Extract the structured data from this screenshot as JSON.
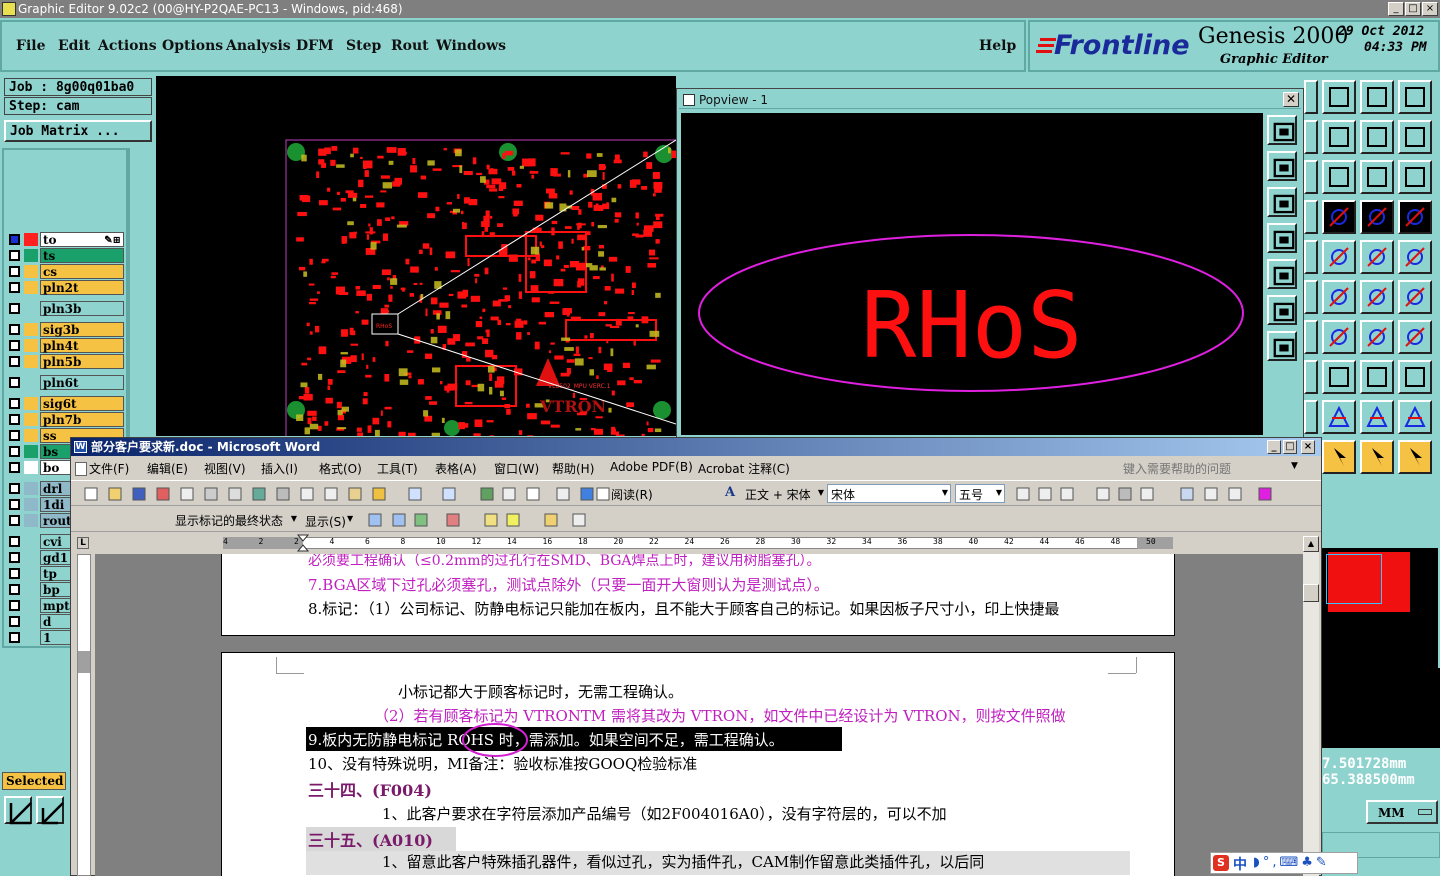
{
  "app": {
    "title": "Graphic Editor 9.02c2 (00@HY-P2QAE-PC13 - Windows, pid:468)",
    "menu": [
      "File",
      "Edit",
      "Actions",
      "Options",
      "Analysis",
      "DFM",
      "Step",
      "Rout",
      "Windows"
    ],
    "help": "Help",
    "brand": "Frontline",
    "product": "Genesis 2000",
    "subtitle": "Graphic Editor",
    "date": "29 Oct 2012",
    "time": "04:33 PM",
    "colors": {
      "panel": "#8fd3cf",
      "canvas": "#000000",
      "copper": "#ff1010",
      "outline": "#e020e0"
    }
  },
  "left_panel": {
    "job": "Job : 8g00q01ba0",
    "step": "Step: cam",
    "job_matrix": "Job Matrix ...",
    "layers": [
      {
        "name": "to",
        "color": "#ffffff",
        "swatch": "#ff2020",
        "flag": "✎⊞"
      },
      {
        "name": "ts",
        "color": "#1aa06a",
        "swatch": "#1aa06a",
        "flag": ""
      },
      {
        "name": "cs",
        "color": "#f5c244",
        "swatch": "#f5c244",
        "flag": ""
      },
      {
        "name": "pln2t",
        "color": "#f5c244",
        "swatch": "#f5c244",
        "flag": ""
      },
      {
        "name": "pln3b",
        "color": "#8fd3cf",
        "swatch": "#8fd3cf",
        "flag": ""
      },
      {
        "name": "sig3b",
        "color": "#f5c244",
        "swatch": "#f5c244",
        "flag": ""
      },
      {
        "name": "pln4t",
        "color": "#f5c244",
        "swatch": "#f5c244",
        "flag": ""
      },
      {
        "name": "pln5b",
        "color": "#f5c244",
        "swatch": "#f5c244",
        "flag": ""
      },
      {
        "name": "pln6t",
        "color": "#8fd3cf",
        "swatch": "#8fd3cf",
        "flag": ""
      },
      {
        "name": "sig6t",
        "color": "#f5c244",
        "swatch": "#f5c244",
        "flag": ""
      },
      {
        "name": "pln7b",
        "color": "#f5c244",
        "swatch": "#f5c244",
        "flag": ""
      },
      {
        "name": "ss",
        "color": "#f5c244",
        "swatch": "#f5c244",
        "flag": ""
      },
      {
        "name": "bs",
        "color": "#1aa06a",
        "swatch": "#1aa06a",
        "flag": ""
      },
      {
        "name": "bo",
        "color": "#ffffff",
        "swatch": "#ffffff",
        "flag": "✎"
      },
      {
        "name": "drl",
        "color": "#8fb8c8",
        "swatch": "#8fb8c8",
        "flag": ""
      },
      {
        "name": "1di",
        "color": "#8fb8c8",
        "swatch": "#8fb8c8",
        "flag": ""
      },
      {
        "name": "rout",
        "color": "#8fb8c8",
        "swatch": "#8fb8c8",
        "flag": ""
      },
      {
        "name": "cvi",
        "color": "#8fd3cf",
        "swatch": "#8fd3cf",
        "flag": ""
      },
      {
        "name": "gd1",
        "color": "#8fd3cf",
        "swatch": "#8fd3cf",
        "flag": ""
      },
      {
        "name": "tp",
        "color": "#8fd3cf",
        "swatch": "#8fd3cf",
        "flag": ""
      },
      {
        "name": "bp",
        "color": "#8fd3cf",
        "swatch": "#8fd3cf",
        "flag": ""
      },
      {
        "name": "mpt",
        "color": "#8fd3cf",
        "swatch": "#8fd3cf",
        "flag": ""
      },
      {
        "name": "d",
        "color": "#8fd3cf",
        "swatch": "#8fd3cf",
        "flag": ""
      },
      {
        "name": "1",
        "color": "#8fd3cf",
        "swatch": "#8fd3cf",
        "flag": ""
      }
    ],
    "selected_label": "Selected"
  },
  "canvas": {
    "board_label": "VL8502_MPU VERC.1",
    "board_brand": "VTRON",
    "marker": "RHoS"
  },
  "popview": {
    "title": "Popview - 1",
    "zoom_text": "RHoS"
  },
  "status": {
    "coord_x": "7.501728mm",
    "coord_y": "65.388500mm",
    "units": "MM"
  },
  "word": {
    "title": "部分客户要求新.doc - Microsoft Word",
    "menu": [
      "文件(F)",
      "编辑(E)",
      "视图(V)",
      "插入(I)",
      "格式(O)",
      "工具(T)",
      "表格(A)",
      "窗口(W)",
      "帮助(H)",
      "Adobe PDF(B)",
      "Acrobat 注释(C)"
    ],
    "help_placeholder": "键入需要帮助的问题",
    "read_label": "阅读(R)",
    "style_box": "正文 + 宋体",
    "font_box": "宋体",
    "size_box": "五号",
    "review_box": "显示标记的最终状态",
    "show_label": "显示(S)",
    "lines_page1": [
      "必须要工程确认（≤0.2mm的过孔行在SMD、BGA焊点上时，建议用树脂塞孔）。",
      "7.BGA区域下过孔必须塞孔，测试点除外（只要一面开大窗则认为是测试点）。",
      "8.标记：（1）公司标记、防静电标记只能加在板内，且不能大于顾客自己的标记。如果因板子尺寸小，印上快捷最"
    ],
    "lines_page2": [
      "小标记都大于顾客标记时，无需工程确认。",
      "（2）若有顾客标记为 VTRONTM 需将其改为 VTRON，如文件中已经设计为 VTRON，则按文件照做",
      "9.板内无防静电标记 ROHS 时，需添加。如果空间不足，需工程确认。",
      "10、没有特殊说明，MI备注：验收标准按GOOQ检验标准",
      "三十四、(F004)",
      "1、此客户要求在字符层添加产品编号（如2F004016A0），没有字符层的，可以不加",
      "三十五、(A010)",
      "1、留意此客户特殊插孔器件，看似过孔，实为插件孔，CAM制作留意此类插件孔，以后同"
    ],
    "ruler_ticks": [
      "4",
      "2",
      "2",
      "4",
      "6",
      "8",
      "10",
      "12",
      "14",
      "16",
      "18",
      "20",
      "22",
      "24",
      "26",
      "28",
      "30",
      "32",
      "34",
      "36",
      "38",
      "40",
      "42",
      "44",
      "46",
      "48",
      "50"
    ],
    "ime": "中"
  }
}
